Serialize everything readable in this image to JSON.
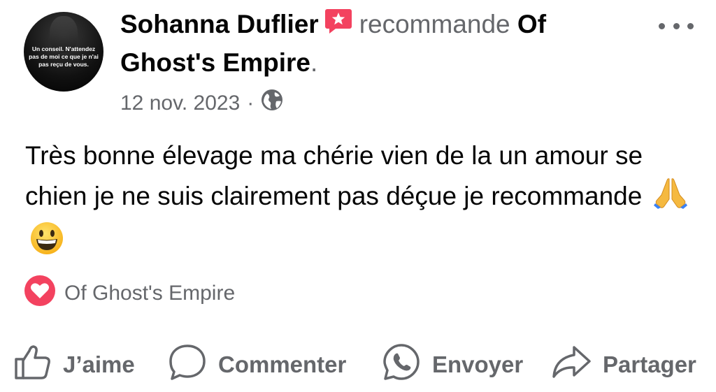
{
  "post": {
    "author": {
      "name": "Sohanna Duflier",
      "avatar_quote": "Un conseil. N'attendez pas de moi ce que je n'ai pas reçu de vous."
    },
    "verb": "recommande",
    "page_name_part1": "Of",
    "page_name_part2": "Ghost's Empire",
    "page_name_end": ".",
    "date": "12 nov. 2023",
    "date_separator": "·",
    "visibility_icon": "globe-icon",
    "text": "Très bonne élevage ma chérie vien de la un amour se chien je ne suis clairement pas déçue je recommande",
    "emojis": [
      "🙏",
      "😀"
    ],
    "recommendation_label": "Of Ghost's Empire"
  },
  "actions": {
    "like_label": "J’aime",
    "comment_label": "Commenter",
    "send_label": "Envoyer",
    "share_label": "Partager"
  },
  "colors": {
    "text_primary": "#050505",
    "text_secondary": "#65676b",
    "recommend_red": "#f3425f"
  }
}
